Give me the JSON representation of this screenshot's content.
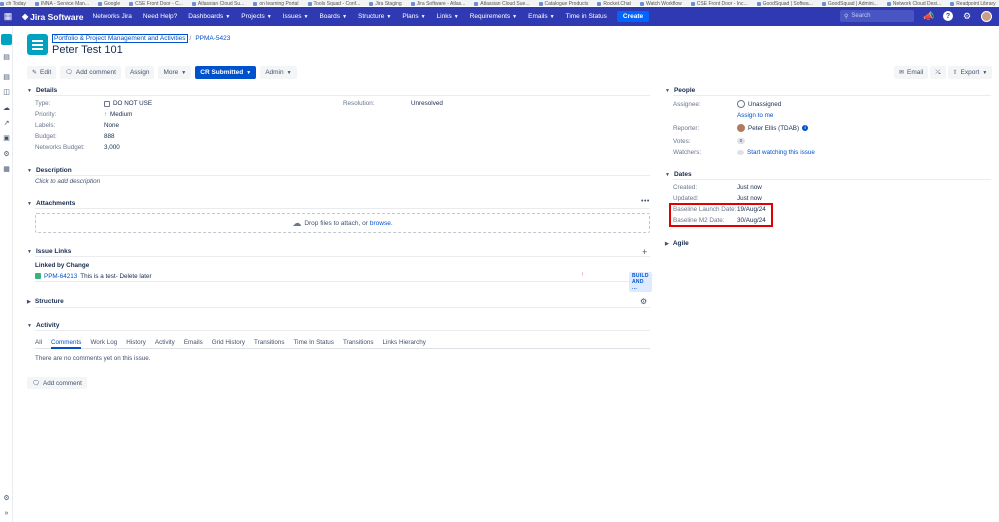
{
  "bookmarks": [
    "ch Today",
    "INNA - Service Man...",
    "Google",
    "CSE Front Door - C...",
    "Atlassian Cloud Su...",
    "on learning Portal",
    "Tools Squad - Conf...",
    "Jira Staging",
    "Jira Software - Atlas...",
    "Atlassian Cloud Sue...",
    "Catalogue Products",
    "Rocket.Chat",
    "Watch Workflow",
    "CSE Front Door - Inc...",
    "GoodSquad | Softwa...",
    "GoodSquad | Admini...",
    "Network Cloud Desi...",
    "Readpoint Library"
  ],
  "topnav": {
    "logo": "Jira Software",
    "items": [
      {
        "label": "Networks Jira",
        "caret": false
      },
      {
        "label": "Need Help?",
        "caret": false
      },
      {
        "label": "Dashboards",
        "caret": true
      },
      {
        "label": "Projects",
        "caret": true
      },
      {
        "label": "Issues",
        "caret": true
      },
      {
        "label": "Boards",
        "caret": true
      },
      {
        "label": "Structure",
        "caret": true
      },
      {
        "label": "Plans",
        "caret": true
      },
      {
        "label": "Links",
        "caret": true
      },
      {
        "label": "Requirements",
        "caret": true
      },
      {
        "label": "Emails",
        "caret": true
      },
      {
        "label": "Time in Status",
        "caret": false
      }
    ],
    "create": "Create",
    "search_placeholder": "Search",
    "help": "?"
  },
  "issue": {
    "project": "Portfolio & Project Management and Activities",
    "separator": "/",
    "key": "PPMA-5423",
    "title": "Peter Test 101"
  },
  "toolbar": {
    "edit": "Edit",
    "add_comment": "Add comment",
    "assign": "Assign",
    "more": "More",
    "status": "CR Submitted",
    "admin": "Admin",
    "email": "Email",
    "export": "Export"
  },
  "details": {
    "heading": "Details",
    "type_label": "Type:",
    "type_value": "DO NOT USE",
    "priority_label": "Priority:",
    "priority_value": "Medium",
    "labels_label": "Labels:",
    "labels_value": "None",
    "budget_label": "Budget:",
    "budget_value": "888",
    "networks_budget_label": "Networks Budget:",
    "networks_budget_value": "3,000",
    "resolution_label": "Resolution:",
    "resolution_value": "Unresolved"
  },
  "description": {
    "heading": "Description",
    "placeholder": "Click to add description"
  },
  "attachments": {
    "heading": "Attachments",
    "more": "•••",
    "drop_text": "Drop files to attach, or",
    "browse": "browse."
  },
  "issue_links": {
    "heading": "Issue Links",
    "group": "Linked by Change",
    "key": "PPM-64213",
    "summary": "This is a test- Delete later",
    "status": "BUILD AND ..."
  },
  "structure": {
    "heading": "Structure"
  },
  "activity": {
    "heading": "Activity",
    "tabs": [
      "All",
      "Comments",
      "Work Log",
      "History",
      "Activity",
      "Emails",
      "Grid History",
      "Transitions",
      "Time In Status",
      "Transitions",
      "Links Hierarchy"
    ],
    "active_tab": 1,
    "empty": "There are no comments yet on this issue.",
    "add_comment": "Add comment"
  },
  "people": {
    "heading": "People",
    "assignee_label": "Assignee:",
    "assignee_value": "Unassigned",
    "assign_to_me": "Assign to me",
    "reporter_label": "Reporter:",
    "reporter_value": "Peter Ellis (TDAB)",
    "votes_label": "Votes:",
    "votes_value": "0",
    "watchers_label": "Watchers:",
    "watchers_value": "Start watching this issue"
  },
  "dates": {
    "heading": "Dates",
    "created_label": "Created:",
    "created_value": "Just now",
    "updated_label": "Updated:",
    "updated_value": "Just now",
    "launch_label": "Baseline Launch Date:",
    "launch_value": "19/Aug/24",
    "m2_label": "Baseline M2 Date:",
    "m2_value": "30/Aug/24"
  },
  "agile": {
    "heading": "Agile"
  },
  "colors": {
    "nav": "#2f3ab2",
    "primary": "#0052cc",
    "highlight": "#e00000"
  }
}
